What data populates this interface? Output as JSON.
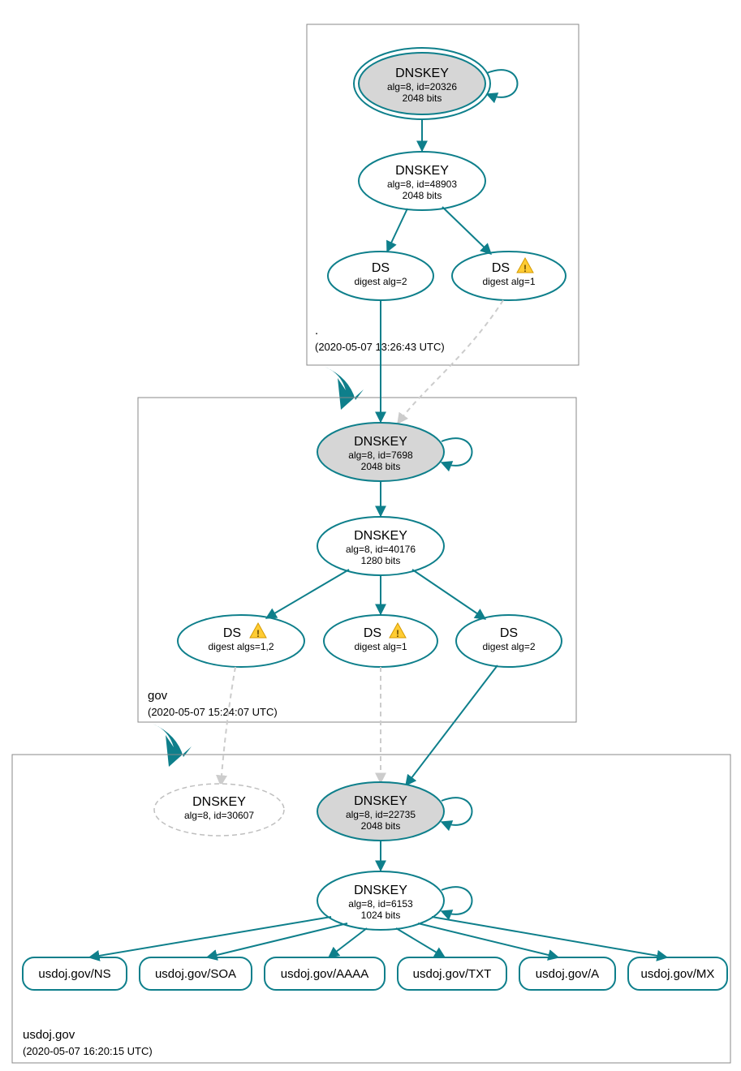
{
  "colors": {
    "accent": "#0e7f8b",
    "node_gray": "#d6d6d6",
    "warn": "#ffcc33",
    "muted_edge": "#cccccc"
  },
  "zones": {
    "root": {
      "label": ".",
      "timestamp": "(2020-05-07 13:26:43 UTC)"
    },
    "gov": {
      "label": "gov",
      "timestamp": "(2020-05-07 15:24:07 UTC)"
    },
    "usdoj": {
      "label": "usdoj.gov",
      "timestamp": "(2020-05-07 16:20:15 UTC)"
    }
  },
  "nodes": {
    "root_ksk": {
      "title": "DNSKEY",
      "line1": "alg=8, id=20326",
      "line2": "2048 bits"
    },
    "root_zsk": {
      "title": "DNSKEY",
      "line1": "alg=8, id=48903",
      "line2": "2048 bits"
    },
    "root_ds2": {
      "title": "DS",
      "line1": "digest alg=2"
    },
    "root_ds1": {
      "title": "DS",
      "line1": "digest alg=1"
    },
    "gov_ksk": {
      "title": "DNSKEY",
      "line1": "alg=8, id=7698",
      "line2": "2048 bits"
    },
    "gov_zsk": {
      "title": "DNSKEY",
      "line1": "alg=8, id=40176",
      "line2": "1280 bits"
    },
    "gov_ds12": {
      "title": "DS",
      "line1": "digest algs=1,2"
    },
    "gov_ds1": {
      "title": "DS",
      "line1": "digest alg=1"
    },
    "gov_ds2": {
      "title": "DS",
      "line1": "digest alg=2"
    },
    "usdoj_k_ghost": {
      "title": "DNSKEY",
      "line1": "alg=8, id=30607"
    },
    "usdoj_ksk": {
      "title": "DNSKEY",
      "line1": "alg=8, id=22735",
      "line2": "2048 bits"
    },
    "usdoj_zsk": {
      "title": "DNSKEY",
      "line1": "alg=8, id=6153",
      "line2": "1024 bits"
    }
  },
  "rrsets": {
    "ns": "usdoj.gov/NS",
    "soa": "usdoj.gov/SOA",
    "aaaa": "usdoj.gov/AAAA",
    "txt": "usdoj.gov/TXT",
    "a": "usdoj.gov/A",
    "mx": "usdoj.gov/MX"
  },
  "chart_data": {
    "type": "graph",
    "description": "DNSSEC authentication chain / DNSViz-style diagram",
    "zones": [
      {
        "name": ".",
        "timestamp": "2020-05-07 13:26:43 UTC"
      },
      {
        "name": "gov",
        "timestamp": "2020-05-07 15:24:07 UTC"
      },
      {
        "name": "usdoj.gov",
        "timestamp": "2020-05-07 16:20:15 UTC"
      }
    ],
    "nodes": [
      {
        "id": "root_ksk",
        "zone": ".",
        "type": "DNSKEY",
        "alg": 8,
        "key_id": 20326,
        "bits": 2048,
        "trust_anchor": true,
        "self_signed": true
      },
      {
        "id": "root_zsk",
        "zone": ".",
        "type": "DNSKEY",
        "alg": 8,
        "key_id": 48903,
        "bits": 2048
      },
      {
        "id": "root_ds2",
        "zone": ".",
        "type": "DS",
        "digest_alg": 2
      },
      {
        "id": "root_ds1",
        "zone": ".",
        "type": "DS",
        "digest_alg": 1,
        "warning": true
      },
      {
        "id": "gov_ksk",
        "zone": "gov",
        "type": "DNSKEY",
        "alg": 8,
        "key_id": 7698,
        "bits": 2048,
        "self_signed": true
      },
      {
        "id": "gov_zsk",
        "zone": "gov",
        "type": "DNSKEY",
        "alg": 8,
        "key_id": 40176,
        "bits": 1280
      },
      {
        "id": "gov_ds12",
        "zone": "gov",
        "type": "DS",
        "digest_algs": [
          1,
          2
        ],
        "warning": true
      },
      {
        "id": "gov_ds1",
        "zone": "gov",
        "type": "DS",
        "digest_alg": 1,
        "warning": true
      },
      {
        "id": "gov_ds2",
        "zone": "gov",
        "type": "DS",
        "digest_alg": 2
      },
      {
        "id": "usdoj_k_ghost",
        "zone": "usdoj.gov",
        "type": "DNSKEY",
        "alg": 8,
        "key_id": 30607,
        "status": "unavailable"
      },
      {
        "id": "usdoj_ksk",
        "zone": "usdoj.gov",
        "type": "DNSKEY",
        "alg": 8,
        "key_id": 22735,
        "bits": 2048,
        "self_signed": true
      },
      {
        "id": "usdoj_zsk",
        "zone": "usdoj.gov",
        "type": "DNSKEY",
        "alg": 8,
        "key_id": 6153,
        "bits": 1024,
        "self_signed": true
      },
      {
        "id": "rr_ns",
        "zone": "usdoj.gov",
        "type": "RRset",
        "name": "usdoj.gov/NS"
      },
      {
        "id": "rr_soa",
        "zone": "usdoj.gov",
        "type": "RRset",
        "name": "usdoj.gov/SOA"
      },
      {
        "id": "rr_aaaa",
        "zone": "usdoj.gov",
        "type": "RRset",
        "name": "usdoj.gov/AAAA"
      },
      {
        "id": "rr_txt",
        "zone": "usdoj.gov",
        "type": "RRset",
        "name": "usdoj.gov/TXT"
      },
      {
        "id": "rr_a",
        "zone": "usdoj.gov",
        "type": "RRset",
        "name": "usdoj.gov/A"
      },
      {
        "id": "rr_mx",
        "zone": "usdoj.gov",
        "type": "RRset",
        "name": "usdoj.gov/MX"
      }
    ],
    "edges": [
      {
        "from": "root_ksk",
        "to": "root_ksk",
        "style": "self"
      },
      {
        "from": "root_ksk",
        "to": "root_zsk",
        "style": "solid"
      },
      {
        "from": "root_zsk",
        "to": "root_ds2",
        "style": "solid"
      },
      {
        "from": "root_zsk",
        "to": "root_ds1",
        "style": "solid"
      },
      {
        "from": "root_ds2",
        "to": "gov_ksk",
        "style": "solid"
      },
      {
        "from": "root_ds1",
        "to": "gov_ksk",
        "style": "dashed"
      },
      {
        "from": "gov_ksk",
        "to": "gov_ksk",
        "style": "self"
      },
      {
        "from": "gov_ksk",
        "to": "gov_zsk",
        "style": "solid"
      },
      {
        "from": "gov_zsk",
        "to": "gov_ds12",
        "style": "solid"
      },
      {
        "from": "gov_zsk",
        "to": "gov_ds1",
        "style": "solid"
      },
      {
        "from": "gov_zsk",
        "to": "gov_ds2",
        "style": "solid"
      },
      {
        "from": "gov_ds12",
        "to": "usdoj_k_ghost",
        "style": "dashed"
      },
      {
        "from": "gov_ds1",
        "to": "usdoj_ksk",
        "style": "dashed"
      },
      {
        "from": "gov_ds2",
        "to": "usdoj_ksk",
        "style": "solid"
      },
      {
        "from": "usdoj_ksk",
        "to": "usdoj_ksk",
        "style": "self"
      },
      {
        "from": "usdoj_ksk",
        "to": "usdoj_zsk",
        "style": "solid"
      },
      {
        "from": "usdoj_zsk",
        "to": "usdoj_zsk",
        "style": "self"
      },
      {
        "from": "usdoj_zsk",
        "to": "rr_ns",
        "style": "solid"
      },
      {
        "from": "usdoj_zsk",
        "to": "rr_soa",
        "style": "solid"
      },
      {
        "from": "usdoj_zsk",
        "to": "rr_aaaa",
        "style": "solid"
      },
      {
        "from": "usdoj_zsk",
        "to": "rr_txt",
        "style": "solid"
      },
      {
        "from": "usdoj_zsk",
        "to": "rr_a",
        "style": "solid"
      },
      {
        "from": "usdoj_zsk",
        "to": "rr_mx",
        "style": "solid"
      }
    ]
  }
}
